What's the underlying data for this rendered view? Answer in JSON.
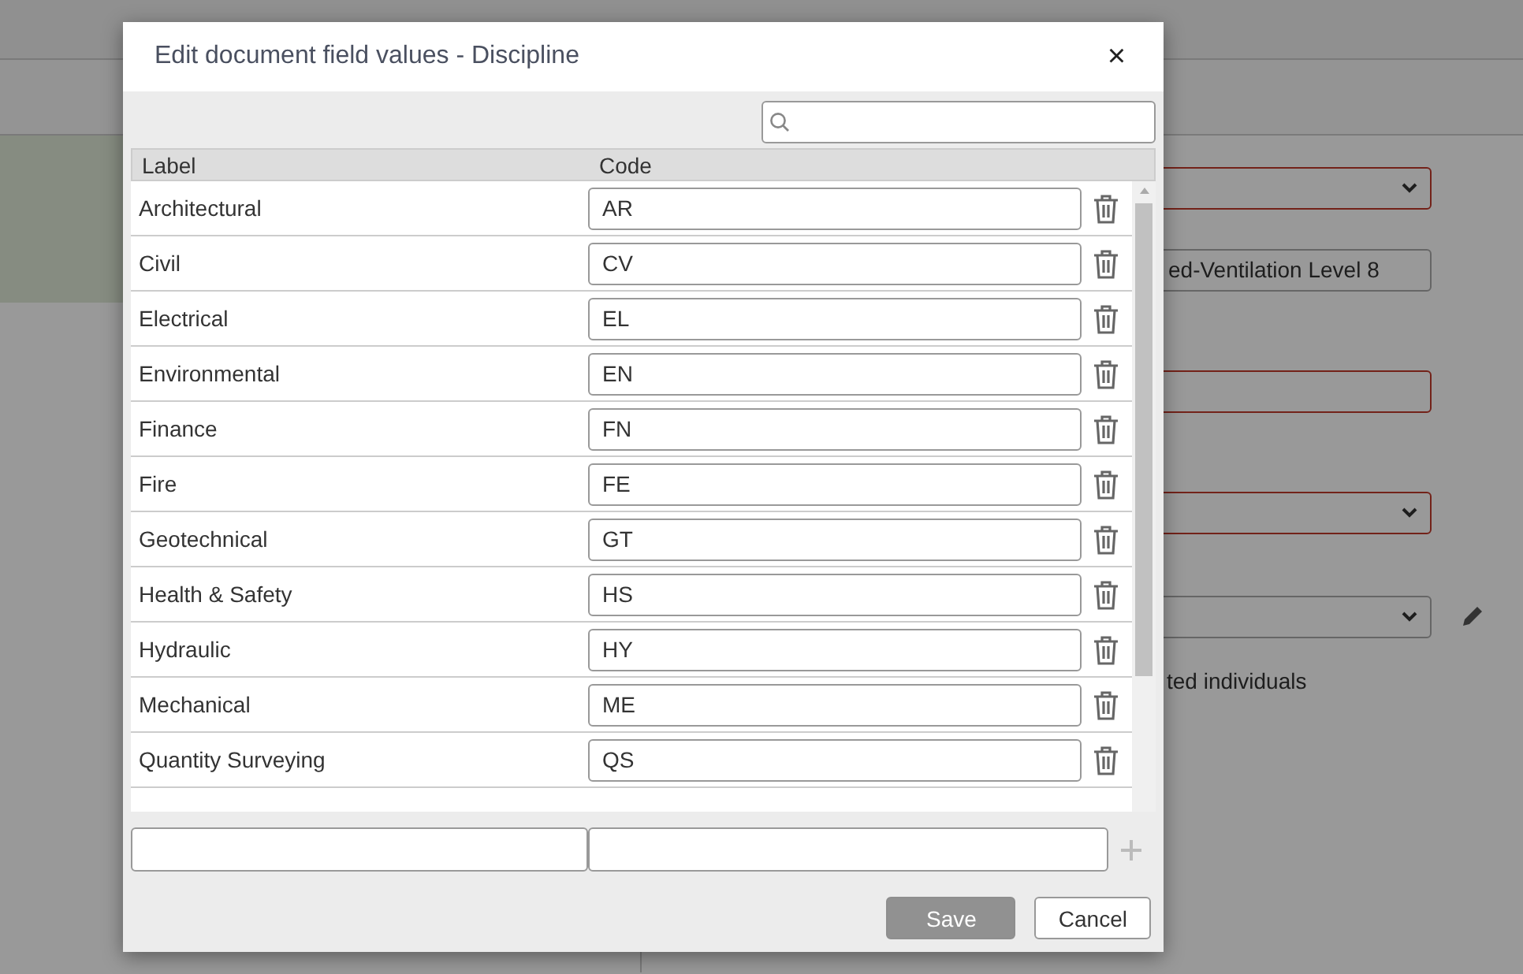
{
  "background": {
    "fields": [
      {
        "kind": "select",
        "invalid": true
      },
      {
        "kind": "text",
        "value": "ed-Ventilation Level 8",
        "invalid": false
      },
      {
        "kind": "text",
        "invalid": true
      },
      {
        "kind": "select",
        "invalid": true
      },
      {
        "kind": "select",
        "invalid": false,
        "editable": true
      }
    ],
    "note": "ted individuals"
  },
  "dialog": {
    "title": "Edit document field values - Discipline",
    "close": "×",
    "columns": [
      "Label",
      "Code"
    ],
    "rows": [
      {
        "label": "Architectural",
        "code": "AR"
      },
      {
        "label": "Civil",
        "code": "CV"
      },
      {
        "label": "Electrical",
        "code": "EL"
      },
      {
        "label": "Environmental",
        "code": "EN"
      },
      {
        "label": "Finance",
        "code": "FN"
      },
      {
        "label": "Fire",
        "code": "FE"
      },
      {
        "label": "Geotechnical",
        "code": "GT"
      },
      {
        "label": "Health & Safety",
        "code": "HS"
      },
      {
        "label": "Hydraulic",
        "code": "HY"
      },
      {
        "label": "Mechanical",
        "code": "ME"
      },
      {
        "label": "Quantity Surveying",
        "code": "QS"
      }
    ],
    "buttons": [
      {
        "label": "Save",
        "kind": "primary",
        "disabled": true
      },
      {
        "label": "Cancel",
        "kind": "secondary",
        "disabled": false
      }
    ]
  }
}
